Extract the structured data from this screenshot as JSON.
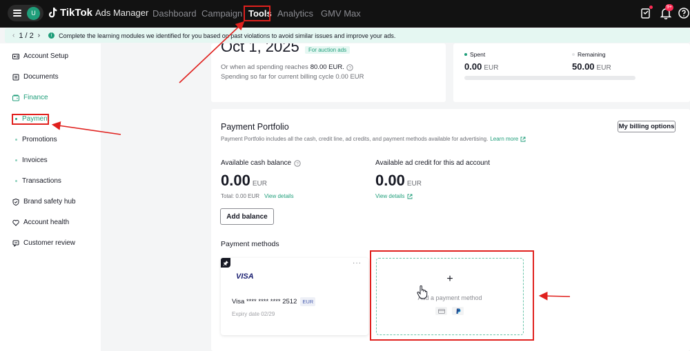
{
  "topbar": {
    "avatar_initial": "U",
    "brand_name": "TikTok",
    "brand_suffix": "Ads Manager",
    "nav": [
      "Dashboard",
      "Campaign",
      "Tools",
      "Analytics",
      "GMV Max"
    ],
    "active_nav": "Tools",
    "notification_badge": "9+"
  },
  "banner": {
    "pager": "1 / 2",
    "message": "Complete the learning modules we identified for you based on past violations to avoid similar issues and improve your ads."
  },
  "sidebar": {
    "items": [
      {
        "label": "Account Setup",
        "icon": "account-setup-icon"
      },
      {
        "label": "Documents",
        "icon": "documents-icon"
      },
      {
        "label": "Finance",
        "icon": "finance-icon"
      }
    ],
    "finance_sub": [
      "Payment",
      "Promotions",
      "Invoices",
      "Transactions"
    ],
    "items_after": [
      {
        "label": "Brand safety hub",
        "icon": "shield-icon"
      },
      {
        "label": "Account health",
        "icon": "health-icon"
      },
      {
        "label": "Customer review",
        "icon": "review-icon"
      }
    ]
  },
  "billing": {
    "date": "Oct 1, 2025",
    "tag": "For auction ads",
    "threshold_text": "Or when ad spending reaches",
    "threshold_value": "80.00 EUR.",
    "spent_so_far": "Spending so far for current billing cycle 0.00 EUR"
  },
  "budget": {
    "spent_label": "Spent",
    "spent_value": "0.00",
    "spent_currency": "EUR",
    "remaining_label": "Remaining",
    "remaining_value": "50.00",
    "remaining_currency": "EUR"
  },
  "portfolio": {
    "title": "Payment Portfolio",
    "description": "Payment Portfolio includes all the cash, credit line, ad credits, and payment methods available for advertising.",
    "learn_more": "Learn more",
    "billing_options_btn": "My billing options",
    "cash_label": "Available cash balance",
    "cash_value": "0.00",
    "cash_currency": "EUR",
    "total_text": "Total: 0.00 EUR",
    "view_details": "View details",
    "credit_label": "Available ad credit for this ad account",
    "credit_value": "0.00",
    "credit_currency": "EUR",
    "credit_view_details": "View details",
    "add_balance_btn": "Add balance"
  },
  "payment_methods": {
    "title": "Payment methods",
    "card_brand": "VISA",
    "card_number": "Visa **** **** **** 2512",
    "card_currency": "EUR",
    "expiry": "Expiry date 02/29",
    "more": "···",
    "add_label": "Add a payment method",
    "add_plus": "+"
  },
  "colors": {
    "accent": "#1f9e7a",
    "annotation_red": "#e0201d",
    "topbar_bg": "#121212"
  }
}
